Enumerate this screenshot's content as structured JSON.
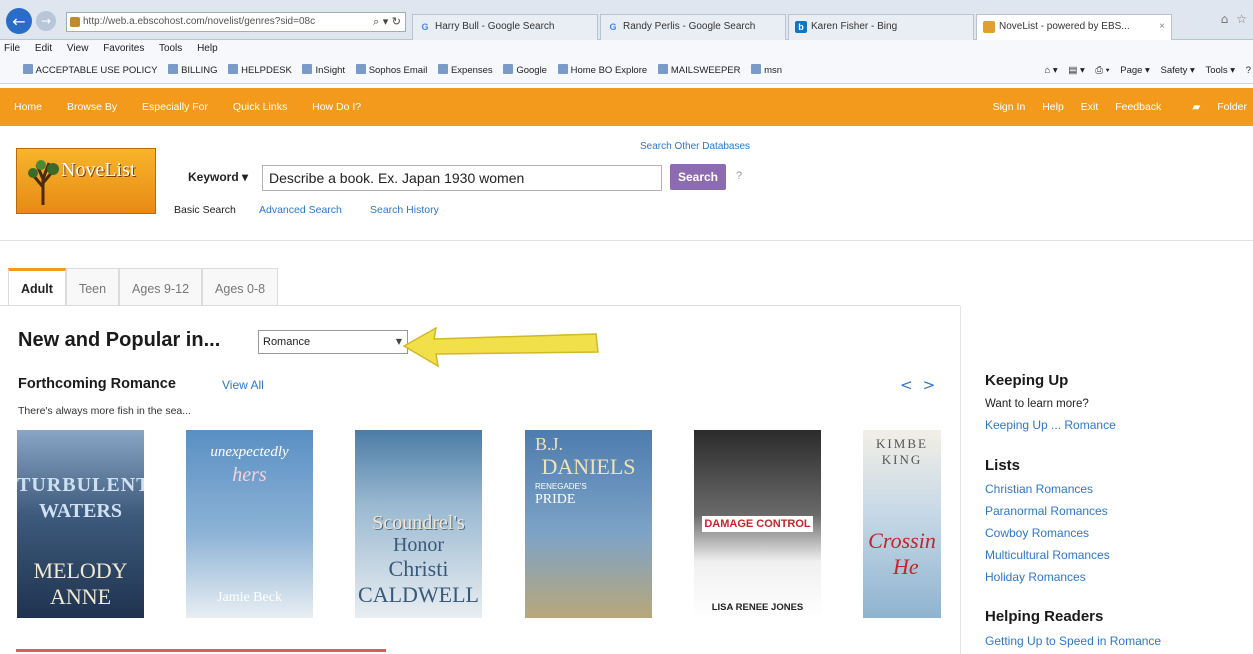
{
  "browser": {
    "address": "http://web.a.ebscohost.com/novelist/genres?sid=08c",
    "tabs": [
      {
        "label": "Harry Bull - Google Search"
      },
      {
        "label": "Randy Perlis - Google Search"
      },
      {
        "label": "Karen Fisher - Bing"
      },
      {
        "label": "NoveList - powered by EBS..."
      }
    ],
    "menu": [
      "File",
      "Edit",
      "View",
      "Favorites",
      "Tools",
      "Help"
    ],
    "favorites": [
      "ACCEPTABLE USE POLICY",
      "BILLING",
      "HELPDESK",
      "InSight",
      "Sophos Email",
      "Expenses",
      "Google",
      "Home BO Explore",
      "MAILSWEEPER",
      "msn"
    ],
    "commands": [
      "Page ▾",
      "Safety ▾",
      "Tools ▾"
    ]
  },
  "site_nav": {
    "left": [
      "Home",
      "Browse By",
      "Especially For",
      "Quick Links",
      "How Do I?"
    ],
    "right": [
      "Sign In",
      "Help",
      "Exit",
      "Feedback",
      "Folder"
    ]
  },
  "header": {
    "logo_text": "NoveList",
    "search_other": "Search Other Databases",
    "keyword_label": "Keyword ▾",
    "search_value": "Describe a book. Ex. Japan 1930 women",
    "search_button": "Search",
    "help": "?",
    "basic_search": "Basic Search",
    "advanced_search": "Advanced Search",
    "search_history": "Search History"
  },
  "age_tabs": [
    {
      "label": "Adult"
    },
    {
      "label": "Teen"
    },
    {
      "label": "Ages 9-12"
    },
    {
      "label": "Ages 0-8"
    }
  ],
  "main": {
    "title": "New and Popular in...",
    "genre_selected": "Romance",
    "forthcoming_title": "Forthcoming Romance",
    "view_all": "View All",
    "tagline": "There's always more fish in the sea...",
    "carousel_prev": "<",
    "carousel_next": ">",
    "books": [
      {
        "lines": [
          "TURBULENT",
          "WATERS",
          "MELODY",
          "ANNE"
        ],
        "color": "#2f4b6c"
      },
      {
        "lines": [
          "unexpectedly",
          "hers",
          "Jamie Beck"
        ],
        "color": "#5b8fbf"
      },
      {
        "lines": [
          "Scoundrel's",
          "Honor",
          "Christi",
          "CALDWELL"
        ],
        "color": "#3f6f96"
      },
      {
        "lines": [
          "B.J.",
          "DANIELS",
          "RENEGADE'S",
          "PRIDE"
        ],
        "color": "#6c8fb4"
      },
      {
        "lines": [
          "DAMAGE CONTROL",
          "LISA RENEE JONES"
        ],
        "color": "#e8e8e8"
      },
      {
        "lines": [
          "KIMBE",
          "KING",
          "Crossin",
          "He"
        ],
        "color": "#8fb3cf"
      }
    ]
  },
  "sidebar": {
    "keeping_up_title": "Keeping Up",
    "keeping_up_text": "Want to learn more?",
    "keeping_up_link": "Keeping Up ... Romance",
    "lists_title": "Lists",
    "lists": [
      "Christian Romances",
      "Paranormal Romances",
      "Cowboy Romances",
      "Multicultural Romances",
      "Holiday Romances"
    ],
    "helping_title": "Helping Readers",
    "helping_link": "Getting Up to Speed in Romance"
  },
  "colors": {
    "orange": "#f39a1d",
    "link_blue": "#2d78c8",
    "search_purple": "#8c6bb1"
  }
}
